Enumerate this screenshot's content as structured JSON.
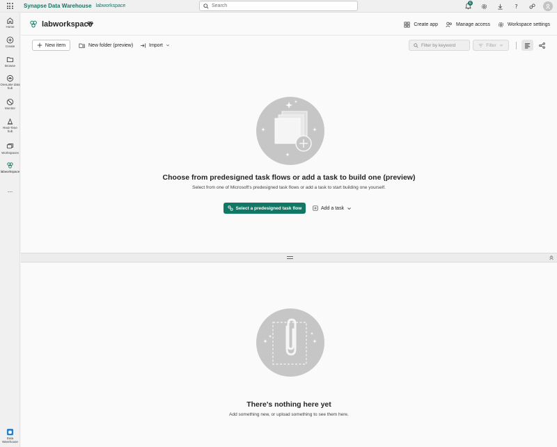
{
  "topbar": {
    "brand": "Synapse Data Warehouse",
    "workspace": "labworkspace",
    "search_placeholder": "Search",
    "notification_count": "6",
    "icons": [
      "waffle-icon",
      "bell-icon",
      "gear-icon",
      "download-icon",
      "help-icon",
      "share-icon",
      "avatar"
    ]
  },
  "leftnav": {
    "items": [
      {
        "label": "Home",
        "icon": "home-icon"
      },
      {
        "label": "Create",
        "icon": "plus-circle-icon"
      },
      {
        "label": "Browse",
        "icon": "folder-icon"
      },
      {
        "label": "OneLake data hub",
        "icon": "onelake-icon"
      },
      {
        "label": "Monitor",
        "icon": "monitor-icon"
      },
      {
        "label": "Real-Time hub",
        "icon": "realtime-icon"
      },
      {
        "label": "Workspaces",
        "icon": "workspaces-icon"
      },
      {
        "label": "labworkspace",
        "icon": "workspace-icon"
      }
    ],
    "more": "...",
    "bottom_label": "Data Warehouse"
  },
  "header": {
    "title": "labworkspace",
    "create_app": "Create app",
    "manage_access": "Manage access",
    "workspace_settings": "Workspace settings"
  },
  "toolbar": {
    "new_item": "New item",
    "new_folder": "New folder (preview)",
    "import": "Import",
    "filter_placeholder": "Filter by keyword",
    "filter": "Filter"
  },
  "taskflow": {
    "title": "Choose from predesigned task flows or add a task to build one (preview)",
    "subtitle": "Select from one of Microsoft's predesigned task flows or add a task to start building one yourself.",
    "primary_button": "Select a predesigned task flow",
    "add_task": "Add a task"
  },
  "empty": {
    "title": "There's nothing here yet",
    "subtitle": "Add something new, or upload something to see them here."
  },
  "colors": {
    "accent": "#117865",
    "illustration_bg": "#c6c6c6"
  }
}
